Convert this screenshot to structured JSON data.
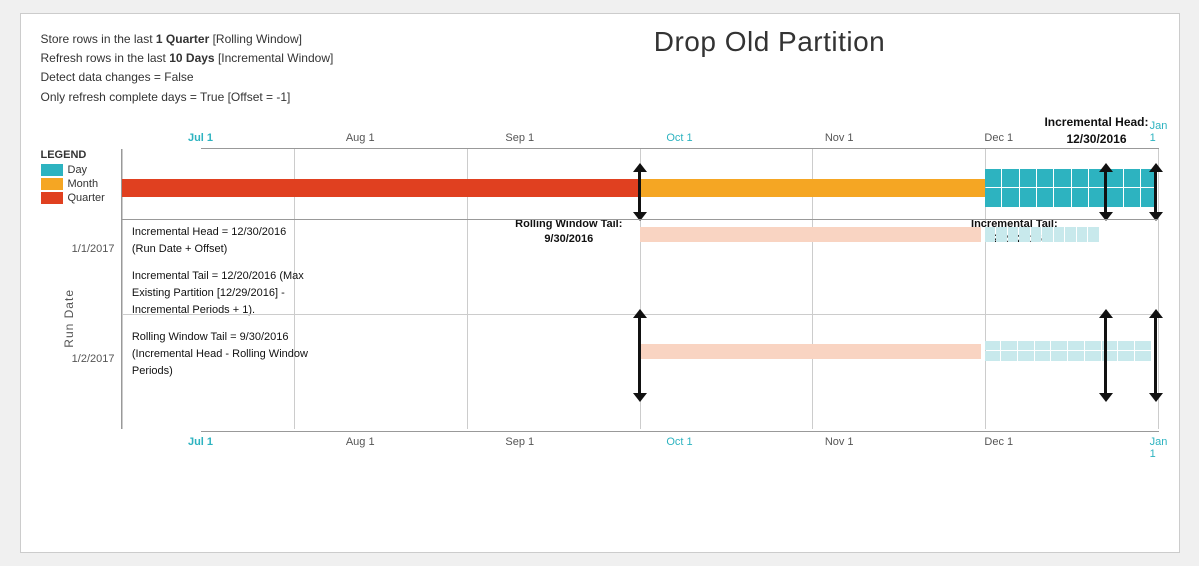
{
  "title": "Drop Old Partition",
  "info": {
    "line1_prefix": "Store rows in the last ",
    "line1_bold": "1 Quarter",
    "line1_suffix": " [Rolling Window]",
    "line2_prefix": "Refresh rows in the last ",
    "line2_bold": "10 Days",
    "line2_suffix": " [Incremental Window]",
    "line3": "Detect data changes = False",
    "line4": "Only refresh complete days = True [Offset = -1]"
  },
  "incremental_head_label": "Incremental Head:\n12/30/2016",
  "legend": {
    "title": "LEGEND",
    "items": [
      {
        "label": "Day",
        "color": "#2db3c0"
      },
      {
        "label": "Month",
        "color": "#f5a623"
      },
      {
        "label": "Quarter",
        "color": "#e04020"
      }
    ]
  },
  "axis": {
    "labels": [
      "Jul 1",
      "Aug 1",
      "Sep 1",
      "Oct 1",
      "Nov 1",
      "Dec 1",
      "Jan 1"
    ],
    "positions_pct": [
      0,
      16.67,
      33.33,
      50,
      66.67,
      83.33,
      100
    ]
  },
  "annotations": {
    "incremental_head": "Incremental Head = 12/30/2016\n(Run Date + Offset)",
    "incremental_tail": "Incremental Tail = 12/20/2016 (Max\nExisting Partition [12/29/2016] -\nIncremental Periods + 1).",
    "rolling_window_tail": "Rolling Window Tail = 9/30/2016\n(Incremental Head - Rolling Window\nPeriods)",
    "rolling_window_tail_label": "Rolling Window Tail:\n9/30/2016",
    "incremental_tail_label": "Incremental Tail:\n12/20/2016"
  },
  "run_date_axis_label": "Run Date",
  "run_date_1": "1/1/2017",
  "run_date_2": "1/2/2017",
  "colors": {
    "day": "#2db3c0",
    "month": "#f5a623",
    "quarter": "#e04020",
    "quarter_light": "#f7c5b0",
    "day_light": "#b8e8ec",
    "bracket": "#111111",
    "grid": "#cccccc"
  }
}
